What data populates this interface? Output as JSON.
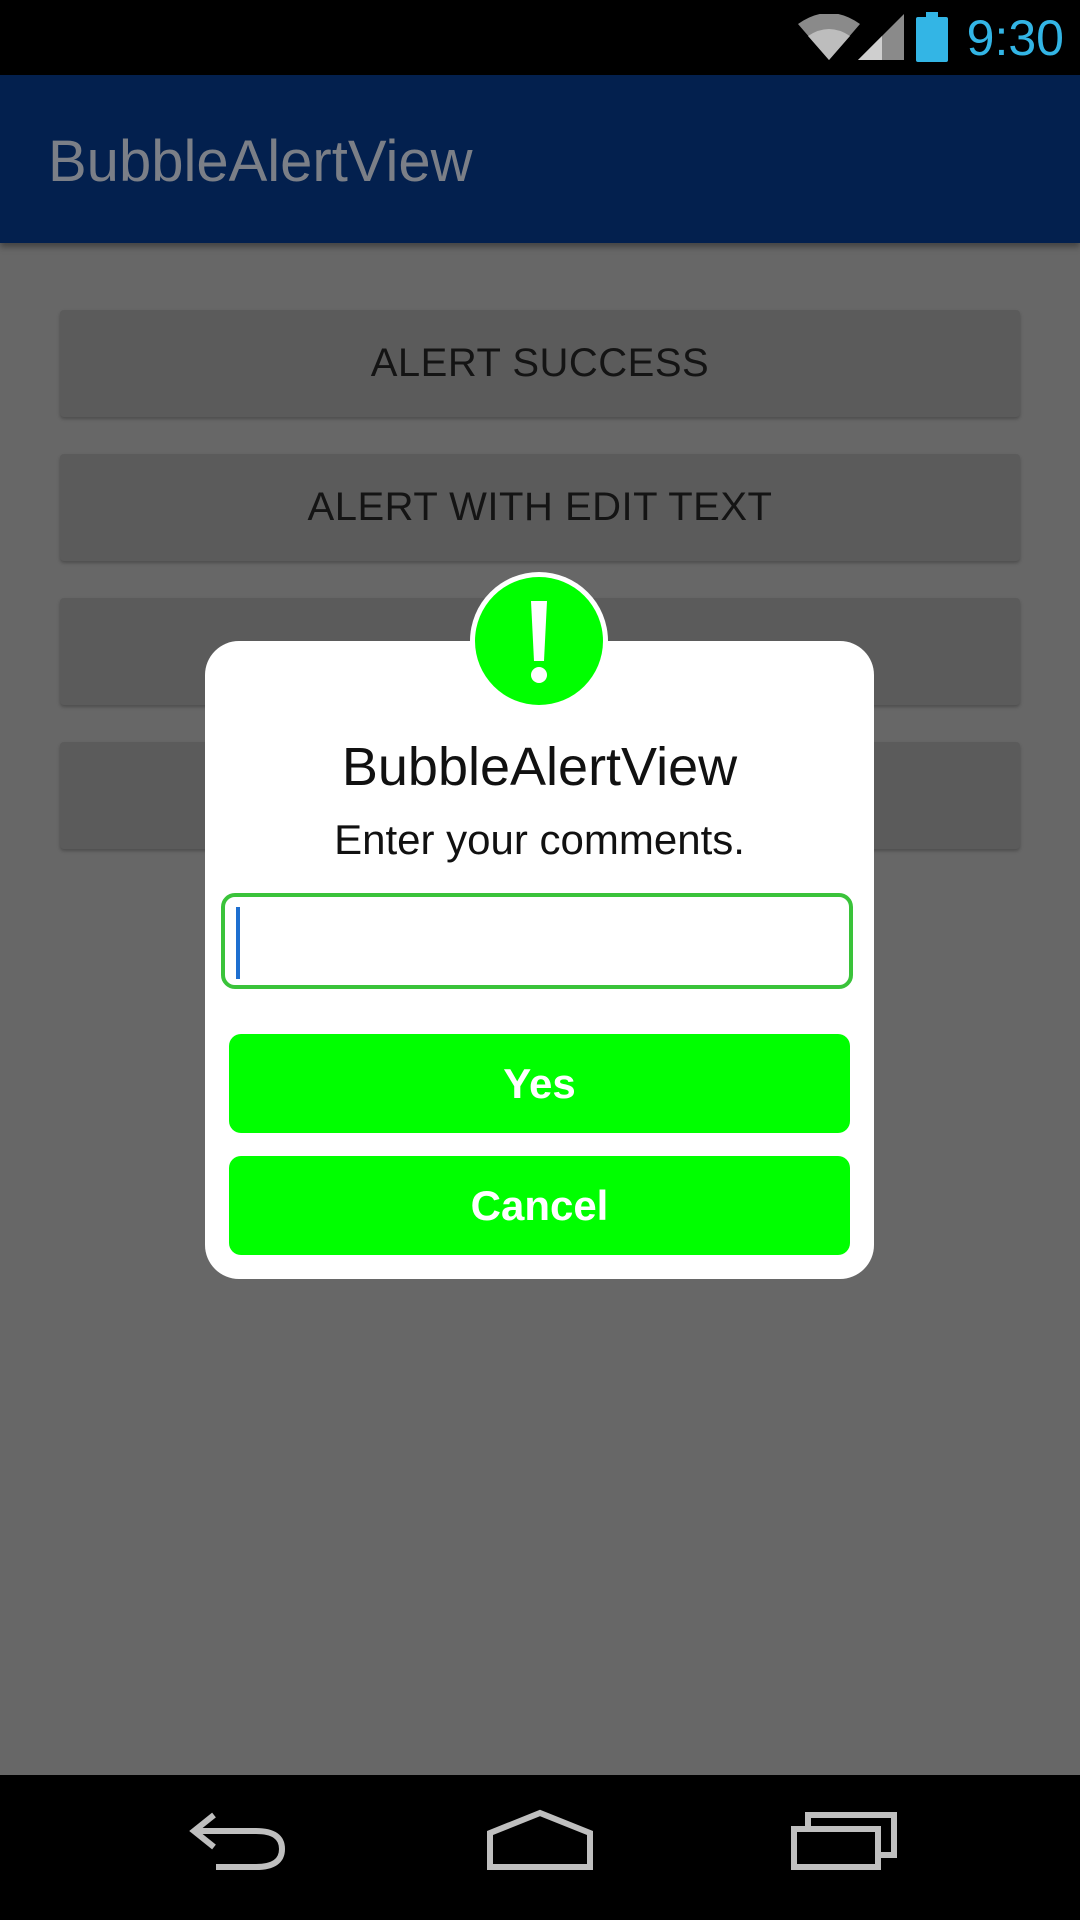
{
  "status_bar": {
    "time": "9:30",
    "icons": [
      "wifi-icon",
      "cell-signal-icon",
      "battery-icon"
    ],
    "time_color": "#33b5e5"
  },
  "action_bar": {
    "title": "BubbleAlertView",
    "background": "#03204e"
  },
  "background_buttons": [
    {
      "label": "ALERT SUCCESS"
    },
    {
      "label": "ALERT WITH EDIT TEXT"
    },
    {
      "label": ""
    },
    {
      "label": ""
    }
  ],
  "dialog": {
    "icon": "exclamation-icon",
    "icon_color": "#00ff00",
    "title": "BubbleAlertView",
    "message": "Enter your comments.",
    "input": {
      "value": "",
      "placeholder": ""
    },
    "buttons": {
      "yes": "Yes",
      "cancel": "Cancel"
    },
    "button_color": "#00ff00"
  },
  "nav_bar": {
    "icons": [
      "back-icon",
      "home-icon",
      "recent-apps-icon"
    ]
  }
}
